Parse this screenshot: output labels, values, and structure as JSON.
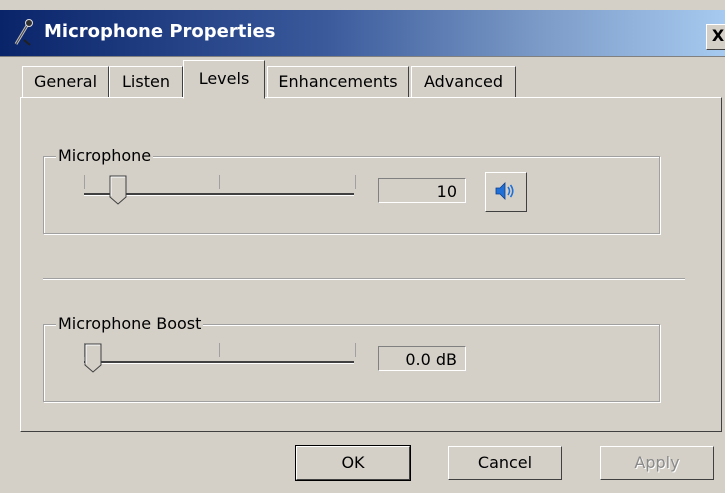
{
  "window": {
    "title": "Microphone Properties",
    "close_label": "X"
  },
  "tabs": [
    {
      "label": "General"
    },
    {
      "label": "Listen"
    },
    {
      "label": "Levels",
      "active": true
    },
    {
      "label": "Enhancements"
    },
    {
      "label": "Advanced"
    }
  ],
  "levels": {
    "microphone": {
      "label": "Microphone",
      "value": "10",
      "level_percent": 10,
      "mute_button_icon": "speaker-icon"
    },
    "boost": {
      "label": "Microphone Boost",
      "value": "0.0 dB",
      "level_percent": 0
    }
  },
  "buttons": {
    "ok": "OK",
    "cancel": "Cancel",
    "apply": "Apply"
  },
  "colors": {
    "titlebar_start": "#0a246a",
    "titlebar_end": "#a6caf0",
    "face": "#d4d0c8",
    "speaker_blue": "#1f6fd6"
  }
}
